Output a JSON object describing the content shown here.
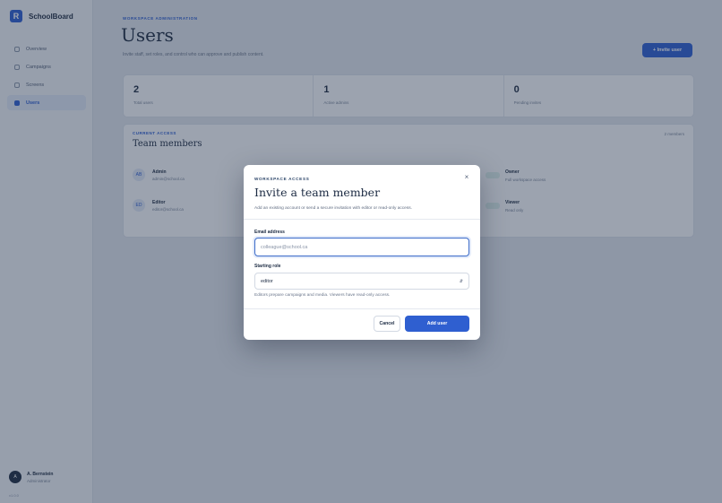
{
  "sidebar": {
    "brand_initial": "R",
    "brand_name": "SchoolBoard",
    "items": [
      {
        "label": "Overview",
        "icon": "grid-icon"
      },
      {
        "label": "Campaigns",
        "icon": "megaphone-icon"
      },
      {
        "label": "Screens",
        "icon": "monitor-icon"
      },
      {
        "label": "Users",
        "icon": "users-icon",
        "active": true
      }
    ],
    "profile": {
      "initials": "A",
      "name": "A. Bernstein",
      "role": "Administrator"
    },
    "version": "v1.0.0"
  },
  "page": {
    "eyebrow": "WORKSPACE ADMINISTRATION",
    "title": "Users",
    "subtitle": "Invite staff, set roles, and control who can approve and publish content.",
    "invite_button": "+ Invite user",
    "stats": [
      {
        "value": "2",
        "label": "Total users"
      },
      {
        "value": "1",
        "label": "Active admins"
      },
      {
        "value": "0",
        "label": "Pending invites"
      }
    ],
    "members": {
      "eyebrow": "CURRENT ACCESS",
      "title": "Team members",
      "count": "2 members",
      "rows": [
        {
          "initials": "AB",
          "name": "Admin",
          "email": "admin@school.ca",
          "side_name": "Owner",
          "side_sub": "Full workspace access"
        },
        {
          "initials": "ED",
          "name": "Editor",
          "email": "editor@school.ca",
          "side_name": "Viewer",
          "side_sub": "Read only"
        }
      ]
    }
  },
  "modal": {
    "eyebrow": "WORKSPACE ACCESS",
    "title": "Invite a team member",
    "description": "Add an existing account or send a secure invitation with editor or read-only access.",
    "email_label": "Email address",
    "email_placeholder": "colleague@school.ca",
    "email_value": "",
    "role_label": "Starting role",
    "role_value": "editor",
    "role_hint": "Editors prepare campaigns and media. Viewers have read-only access.",
    "cancel_label": "Cancel",
    "submit_label": "Add user",
    "close_glyph": "×"
  }
}
